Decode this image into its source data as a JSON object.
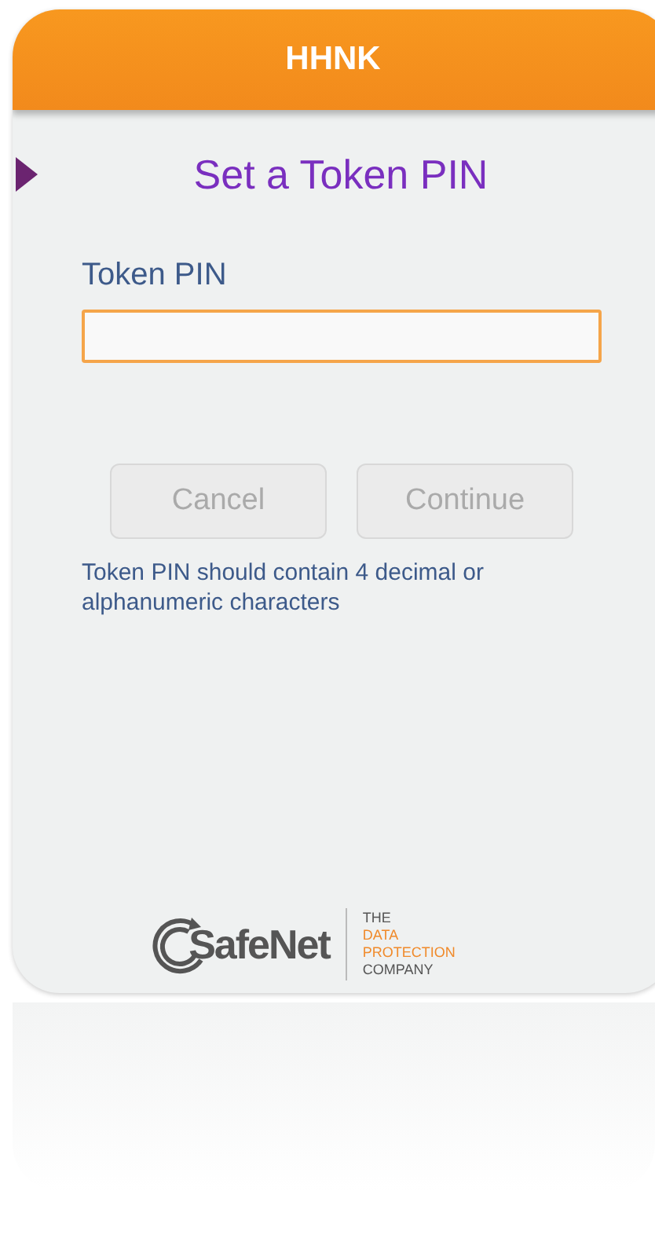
{
  "header": {
    "title": "HHNK"
  },
  "screen": {
    "title": "Set a Token PIN"
  },
  "pin_field": {
    "label": "Token PIN",
    "focused": true
  },
  "buttons": [
    {
      "label": "Cancel",
      "disabled": true
    },
    {
      "label": "Continue",
      "disabled": true
    }
  ],
  "hint": "Token PIN should contain 4 decimal or alphanumeric characters",
  "logo": {
    "wordmark": "SafeNet",
    "tagline": [
      {
        "text": "THE",
        "accent": false
      },
      {
        "text": "DATA",
        "accent": true
      },
      {
        "text": "PROTECTION",
        "accent": true
      },
      {
        "text": "COMPANY",
        "accent": false
      }
    ]
  }
}
